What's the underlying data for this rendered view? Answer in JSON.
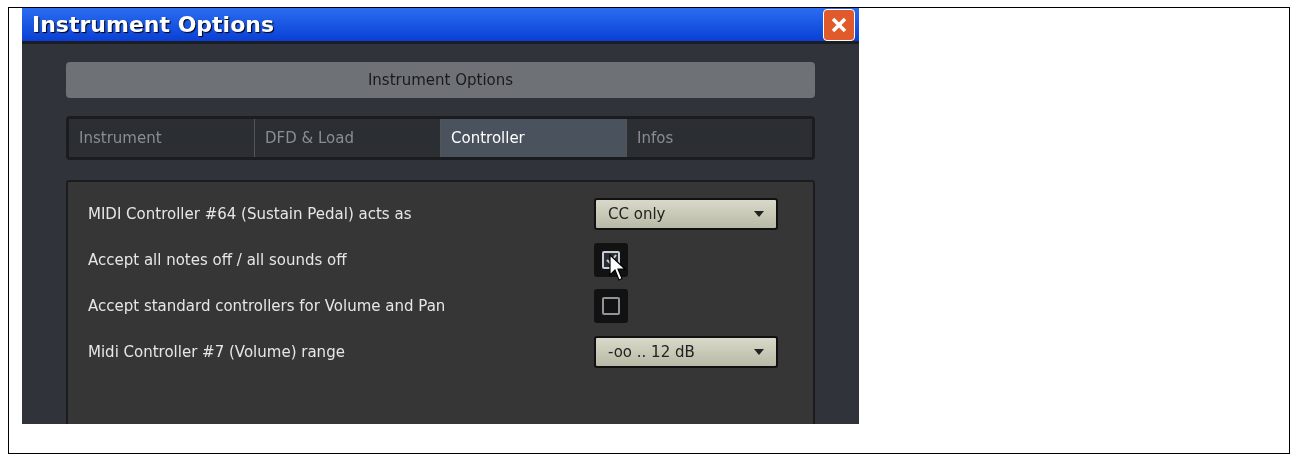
{
  "window": {
    "title": "Instrument Options"
  },
  "header": "Instrument Options",
  "tabs": [
    {
      "label": "Instrument",
      "selected": false
    },
    {
      "label": "DFD & Load",
      "selected": false
    },
    {
      "label": "Controller",
      "selected": true
    },
    {
      "label": "Infos",
      "selected": false
    }
  ],
  "options": [
    {
      "kind": "dropdown",
      "label": "MIDI Controller #64 (Sustain Pedal) acts as",
      "value": "CC only"
    },
    {
      "kind": "checkbox",
      "label": "Accept all notes off / all sounds off",
      "checked": true,
      "cursor": true
    },
    {
      "kind": "checkbox",
      "label": "Accept standard controllers for Volume and Pan",
      "checked": false
    },
    {
      "kind": "dropdown",
      "label": "Midi Controller #7 (Volume) range",
      "value": "-oo .. 12 dB"
    }
  ]
}
